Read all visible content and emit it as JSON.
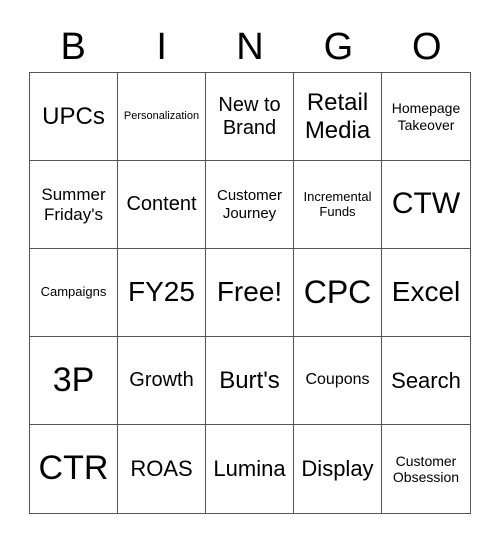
{
  "header": [
    "B",
    "I",
    "N",
    "G",
    "O"
  ],
  "cells": [
    "UPCs",
    "Personalization",
    "New to Brand",
    "Retail Media",
    "Homepage Takeover",
    "Summer Friday's",
    "Content",
    "Customer Journey",
    "Incremental Funds",
    "CTW",
    "Campaigns",
    "FY25",
    "Free!",
    "CPC",
    "Excel",
    "3P",
    "Growth",
    "Burt's",
    "Coupons",
    "Search",
    "CTR",
    "ROAS",
    "Lumina",
    "Display",
    "Customer Obsession"
  ]
}
